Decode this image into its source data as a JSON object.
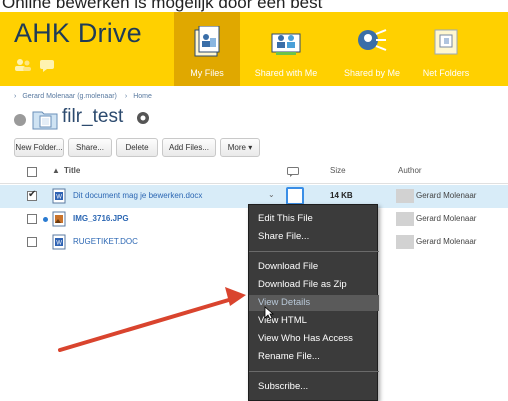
{
  "caption": "Online bewerken is mogelijk door een best",
  "header": {
    "app_title": "AHK Drive",
    "tabs": [
      {
        "label": "My Files",
        "icon": "my-files-icon",
        "active": true
      },
      {
        "label": "Shared with Me",
        "icon": "shared-with-me-icon",
        "active": false
      },
      {
        "label": "Shared by Me",
        "icon": "shared-by-me-icon",
        "active": false
      },
      {
        "label": "Net Folders",
        "icon": "net-folders-icon",
        "active": false
      }
    ]
  },
  "breadcrumb": {
    "items": [
      "Gerard Molenaar (g.molenaar)",
      "Home"
    ]
  },
  "folder": {
    "title": "filr_test"
  },
  "toolbar": {
    "new_folder": "New Folder...",
    "share": "Share...",
    "delete": "Delete",
    "add_files": "Add Files...",
    "more": "More ▾"
  },
  "table": {
    "columns": {
      "title": "Title",
      "size": "Size",
      "author": "Author"
    },
    "rows": [
      {
        "name": "Dit document mag je bewerken.docx",
        "size": "14 KB",
        "author": "Gerard Molenaar",
        "checked": true,
        "selected": true
      },
      {
        "name": "IMG_3716.JPG",
        "size": "",
        "author": "Gerard Molenaar",
        "checked": false,
        "selected": false
      },
      {
        "name": "RUGETIKET.DOC",
        "size": "",
        "author": "Gerard Molenaar",
        "checked": false,
        "selected": false
      }
    ]
  },
  "context_menu": {
    "items": [
      "Edit This File",
      "Share File...",
      "Download File",
      "Download File as Zip",
      "View Details",
      "View HTML",
      "View Who Has Access",
      "Rename File...",
      "Subscribe..."
    ],
    "hovered": "View Details"
  },
  "colors": {
    "header_bg": "#ffd000",
    "active_tab": "#e0a800",
    "title_blue": "#1f3b57",
    "link_blue": "#2c67b3",
    "selected_row": "#d8ecf8",
    "menu_bg": "#3b3b3b",
    "annotation_arrow": "#d9442e"
  }
}
